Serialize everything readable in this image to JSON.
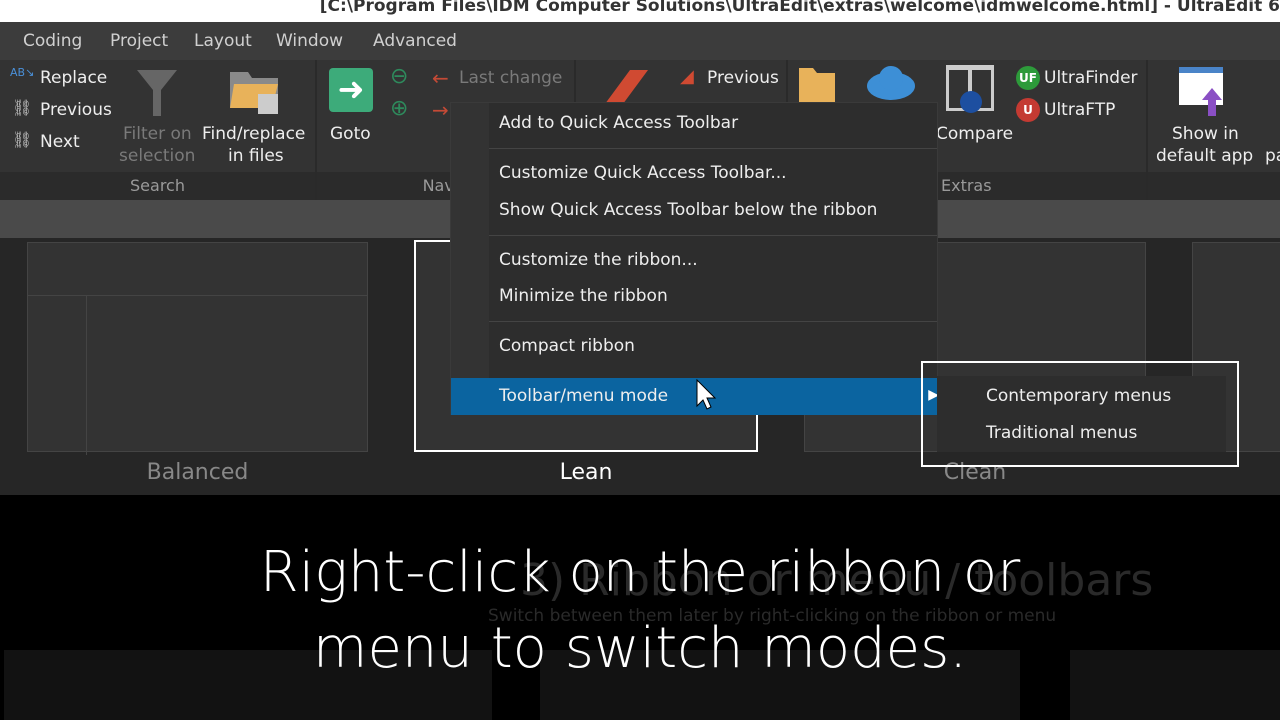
{
  "window": {
    "title": "[C:\\Program Files\\IDM Computer Solutions\\UltraEdit\\extras\\welcome\\idmwelcome.html] - UltraEdit 6"
  },
  "menu_tabs": [
    "Coding",
    "Project",
    "Layout",
    "Window",
    "Advanced"
  ],
  "ribbon": {
    "search": {
      "replace": "Replace",
      "previous": "Previous",
      "next": "Next",
      "filter_l1": "Filter on",
      "filter_l2": "selection",
      "findrep_l1": "Find/replace",
      "findrep_l2": "in files",
      "group": "Search"
    },
    "navigate": {
      "goto": "Goto",
      "last_change": "Last change",
      "group": "Navig"
    },
    "bookmarks": {
      "previous": "Previous"
    },
    "extras": {
      "compare": "Compare",
      "ultrafinder": "UltraFinder",
      "ultraftp": "UltraFTP",
      "group": "Extras"
    },
    "show": {
      "l1": "Show in",
      "l2": "default app",
      "partial": "pa"
    }
  },
  "context_menu": {
    "items": [
      "Add to Quick Access Toolbar",
      "Customize Quick Access Toolbar...",
      "Show Quick Access Toolbar below the ribbon",
      "Customize the ribbon...",
      "Minimize the ribbon",
      "Compact ribbon",
      "Toolbar/menu mode"
    ],
    "highlighted": "Toolbar/menu mode",
    "highlight_color": "#0b64a0"
  },
  "submenu": {
    "items": [
      "Contemporary menus",
      "Traditional menus"
    ]
  },
  "gallery": {
    "options": [
      "Balanced",
      "Lean",
      "Clean"
    ],
    "selected": "Lean"
  },
  "background": {
    "heading": "3) Ribbon or menu / toolbars",
    "subtitle": "Switch between them later by right-clicking on the ribbon or menu"
  },
  "caption": {
    "line1": "Right-click on the ribbon or",
    "line2": "menu to switch modes."
  }
}
